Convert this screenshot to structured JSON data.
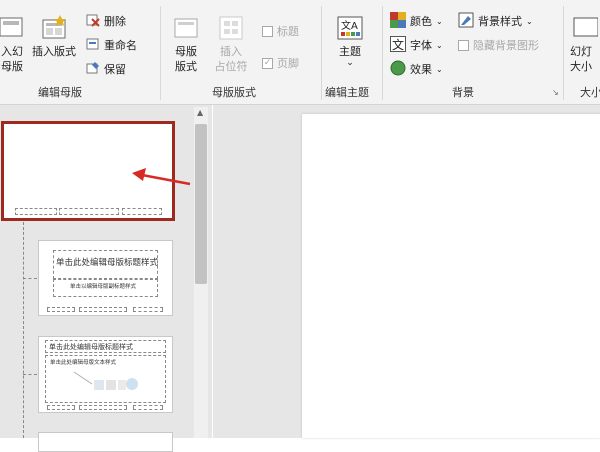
{
  "ribbon": {
    "groups": [
      {
        "label": "编辑母版"
      },
      {
        "label": "母版版式"
      },
      {
        "label": "编辑主题"
      },
      {
        "label": "背景"
      },
      {
        "label": "大小"
      }
    ],
    "insert_slide_master": {
      "line1": "入幻",
      "line2": "母版"
    },
    "insert_layout": {
      "label": "插入版式"
    },
    "delete": {
      "label": "删除"
    },
    "rename": {
      "label": "重命名"
    },
    "preserve": {
      "label": "保留"
    },
    "master_layout": {
      "line1": "母版",
      "line2": "版式"
    },
    "insert_placeholder": {
      "line1": "插入",
      "line2": "占位符"
    },
    "title_checkbox": {
      "label": "标题"
    },
    "footer_checkbox": {
      "label": "页脚"
    },
    "themes": {
      "label": "主题",
      "arrow": "⌄"
    },
    "colors": {
      "label": "颜色"
    },
    "fonts": {
      "label": "字体"
    },
    "effects": {
      "label": "效果"
    },
    "background_styles": {
      "label": "背景样式"
    },
    "hide_background_graphics": {
      "label": "隐藏背景图形"
    },
    "slide_size": {
      "line1": "幻灯",
      "line2": "大小"
    },
    "accent_colors": {
      "red": "#c0392b",
      "selected_border": "#9e2a1e",
      "green": "#4a9a4a"
    }
  },
  "thumbnails": [
    {
      "state": "selected"
    },
    {
      "title": "单击此处编辑母版标题样式",
      "subtitle": "单击以编辑母版副标题样式"
    },
    {
      "title": "单击此处编辑母版标题样式",
      "body": "单击此处编辑母版文本样式"
    }
  ]
}
